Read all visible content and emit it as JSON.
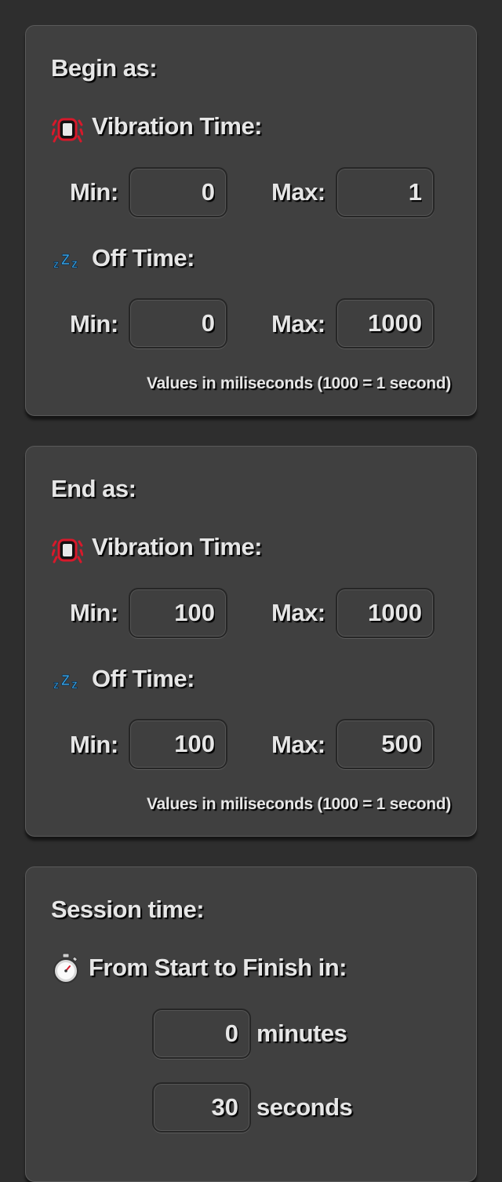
{
  "begin": {
    "title": "Begin as:",
    "vibration": {
      "label": "Vibration Time:",
      "icon": "vibration-icon",
      "min_label": "Min:",
      "min_value": "0",
      "max_label": "Max:",
      "max_value": "1"
    },
    "off": {
      "label": "Off Time:",
      "icon": "sleep-zzz-icon",
      "min_label": "Min:",
      "min_value": "0",
      "max_label": "Max:",
      "max_value": "1000"
    },
    "note": "Values in miliseconds (1000 = 1 second)"
  },
  "end": {
    "title": "End as:",
    "vibration": {
      "label": "Vibration Time:",
      "icon": "vibration-icon",
      "min_label": "Min:",
      "min_value": "100",
      "max_label": "Max:",
      "max_value": "1000"
    },
    "off": {
      "label": "Off Time:",
      "icon": "sleep-zzz-icon",
      "min_label": "Min:",
      "min_value": "100",
      "max_label": "Max:",
      "max_value": "500"
    },
    "note": "Values in miliseconds (1000 = 1 second)"
  },
  "session": {
    "title": "Session time:",
    "label": "From Start to Finish in:",
    "icon": "stopwatch-icon",
    "minutes_value": "0",
    "minutes_label": "minutes",
    "seconds_value": "30",
    "seconds_label": "seconds"
  },
  "colors": {
    "background": "#2e2e2e",
    "panel": "#404040",
    "vibration_icon_accent": "#d7192b",
    "zzz_icon_accent": "#3aa7e8"
  }
}
